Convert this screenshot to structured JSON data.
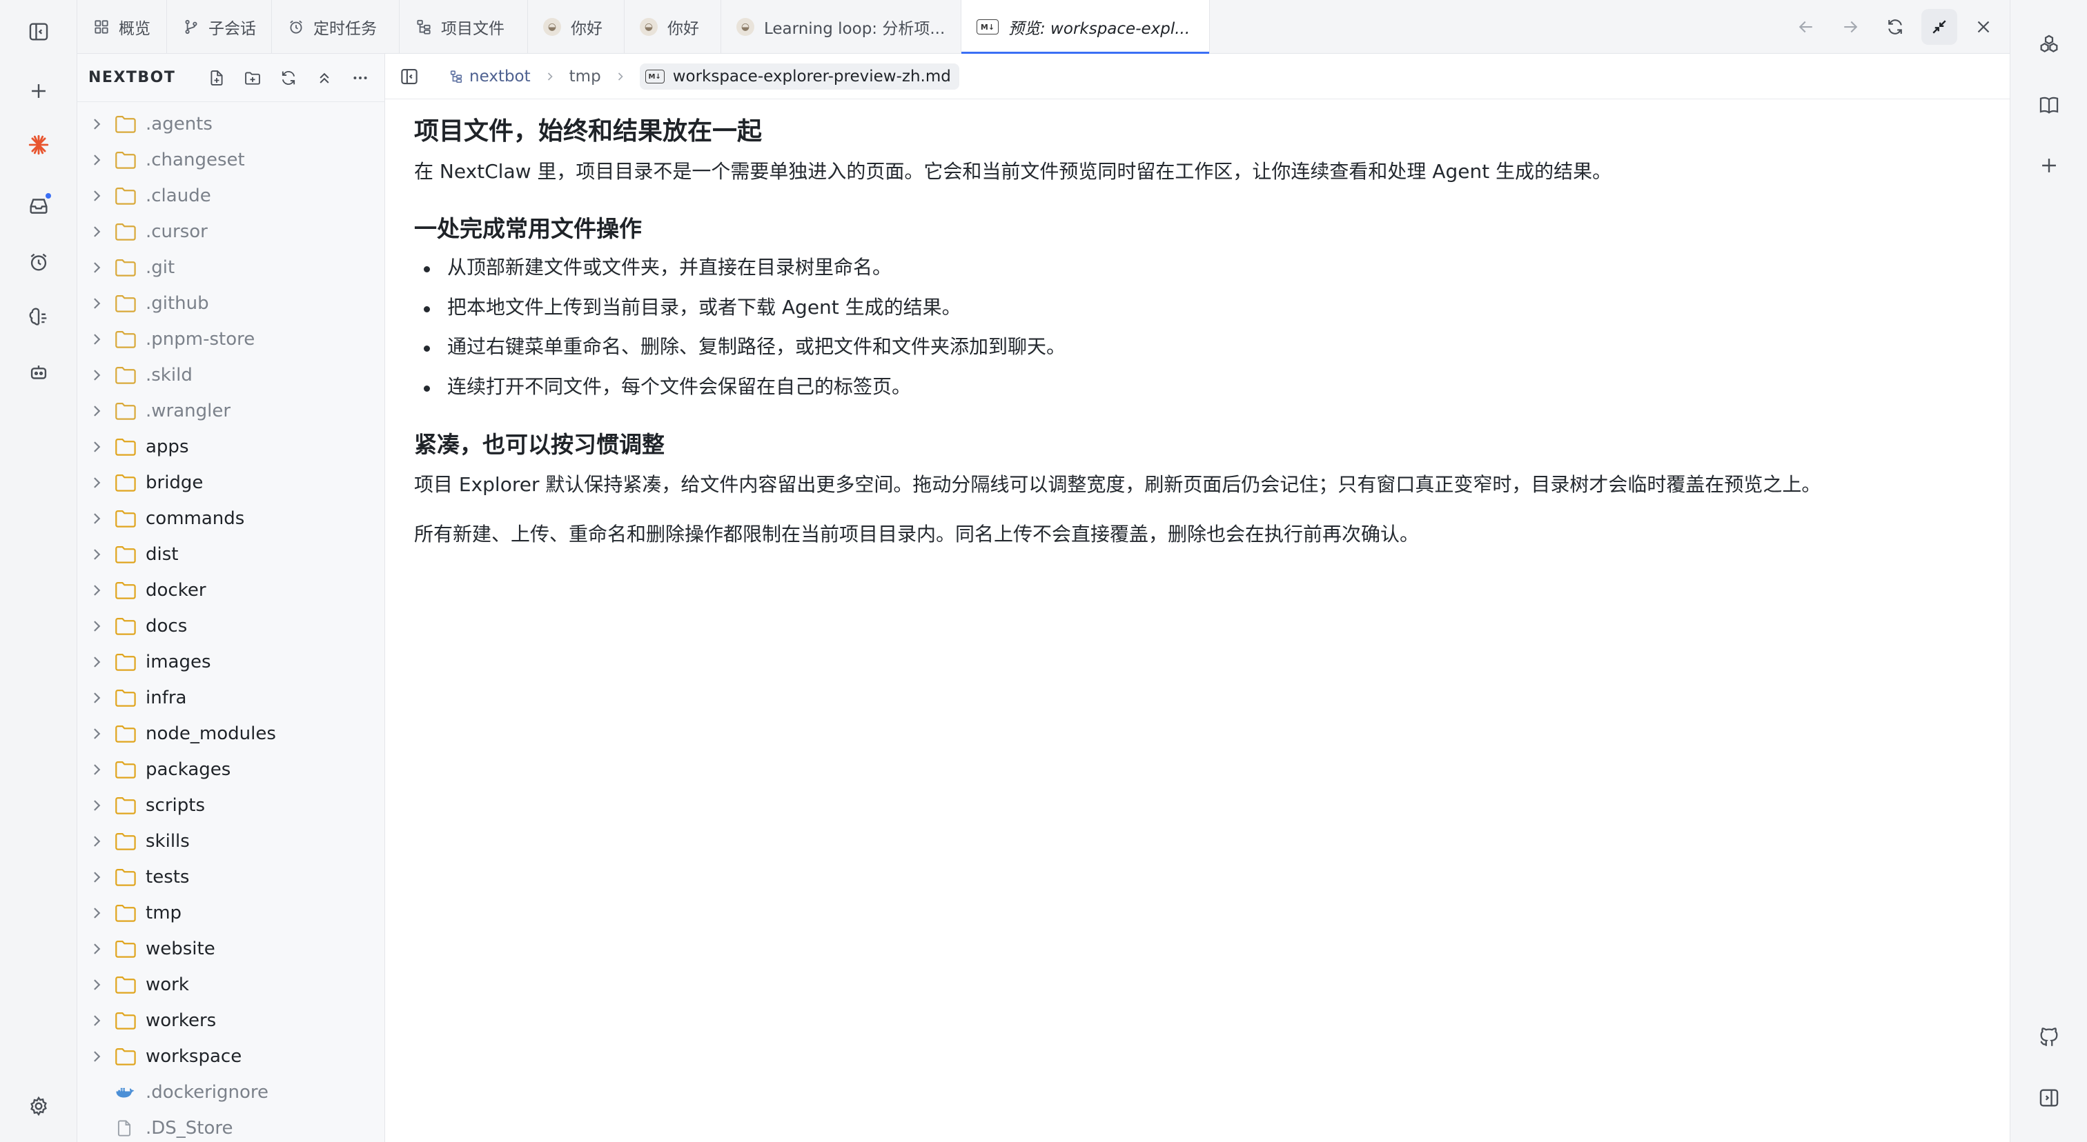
{
  "tabs": [
    {
      "label": "概览",
      "icon": "grid-icon"
    },
    {
      "label": "子会话",
      "icon": "branch-icon"
    },
    {
      "label": "定时任务",
      "icon": "alarm-icon"
    },
    {
      "label": "项目文件",
      "icon": "tree-icon"
    },
    {
      "label": "你好",
      "icon": "avatar-icon"
    },
    {
      "label": "你好",
      "icon": "avatar-icon"
    },
    {
      "label": "Learning loop: 分析项...",
      "icon": "avatar-icon"
    },
    {
      "label": "预览: workspace-expl...",
      "icon": "markdown-icon",
      "active": true
    }
  ],
  "explorer": {
    "title": "NEXTBOT",
    "items": [
      {
        "name": ".agents",
        "type": "folder",
        "dim": true
      },
      {
        "name": ".changeset",
        "type": "folder",
        "dim": true
      },
      {
        "name": ".claude",
        "type": "folder",
        "dim": true
      },
      {
        "name": ".cursor",
        "type": "folder",
        "dim": true
      },
      {
        "name": ".git",
        "type": "folder",
        "dim": true
      },
      {
        "name": ".github",
        "type": "folder",
        "dim": true
      },
      {
        "name": ".pnpm-store",
        "type": "folder",
        "dim": true
      },
      {
        "name": ".skild",
        "type": "folder",
        "dim": true
      },
      {
        "name": ".wrangler",
        "type": "folder",
        "dim": true
      },
      {
        "name": "apps",
        "type": "folder"
      },
      {
        "name": "bridge",
        "type": "folder"
      },
      {
        "name": "commands",
        "type": "folder"
      },
      {
        "name": "dist",
        "type": "folder"
      },
      {
        "name": "docker",
        "type": "folder"
      },
      {
        "name": "docs",
        "type": "folder"
      },
      {
        "name": "images",
        "type": "folder"
      },
      {
        "name": "infra",
        "type": "folder"
      },
      {
        "name": "node_modules",
        "type": "folder"
      },
      {
        "name": "packages",
        "type": "folder"
      },
      {
        "name": "scripts",
        "type": "folder"
      },
      {
        "name": "skills",
        "type": "folder"
      },
      {
        "name": "tests",
        "type": "folder"
      },
      {
        "name": "tmp",
        "type": "folder"
      },
      {
        "name": "website",
        "type": "folder"
      },
      {
        "name": "work",
        "type": "folder"
      },
      {
        "name": "workers",
        "type": "folder"
      },
      {
        "name": "workspace",
        "type": "folder"
      },
      {
        "name": ".dockerignore",
        "type": "file",
        "icon": "docker-icon",
        "dim": true
      },
      {
        "name": ".DS_Store",
        "type": "file",
        "icon": "file-icon",
        "dim": true
      }
    ]
  },
  "breadcrumb": {
    "root": "nextbot",
    "folder": "tmp",
    "file": "workspace-explorer-preview-zh.md"
  },
  "doc": {
    "h1": "项目文件，始终和结果放在一起",
    "p1": "在 NextClaw 里，项目目录不是一个需要单独进入的页面。它会和当前文件预览同时留在工作区，让你连续查看和处理 Agent 生成的结果。",
    "h2": "一处完成常用文件操作",
    "bullets": [
      "从顶部新建文件或文件夹，并直接在目录树里命名。",
      "把本地文件上传到当前目录，或者下载 Agent 生成的结果。",
      "通过右键菜单重命名、删除、复制路径，或把文件和文件夹添加到聊天。",
      "连续打开不同文件，每个文件会保留在自己的标签页。"
    ],
    "h3": "紧凑，也可以按习惯调整",
    "p2": "项目 Explorer 默认保持紧凑，给文件内容留出更多空间。拖动分隔线可以调整宽度，刷新页面后仍会记住；只有窗口真正变窄时，目录树才会临时覆盖在预览之上。",
    "p3": "所有新建、上传、重命名和删除操作都限制在当前项目目录内。同名上传不会直接覆盖，删除也会在执行前再次确认。"
  },
  "colors": {
    "accent": "#3b6ff5",
    "brand_star": "#e8552f",
    "rail_bg": "#f4f5f7"
  }
}
